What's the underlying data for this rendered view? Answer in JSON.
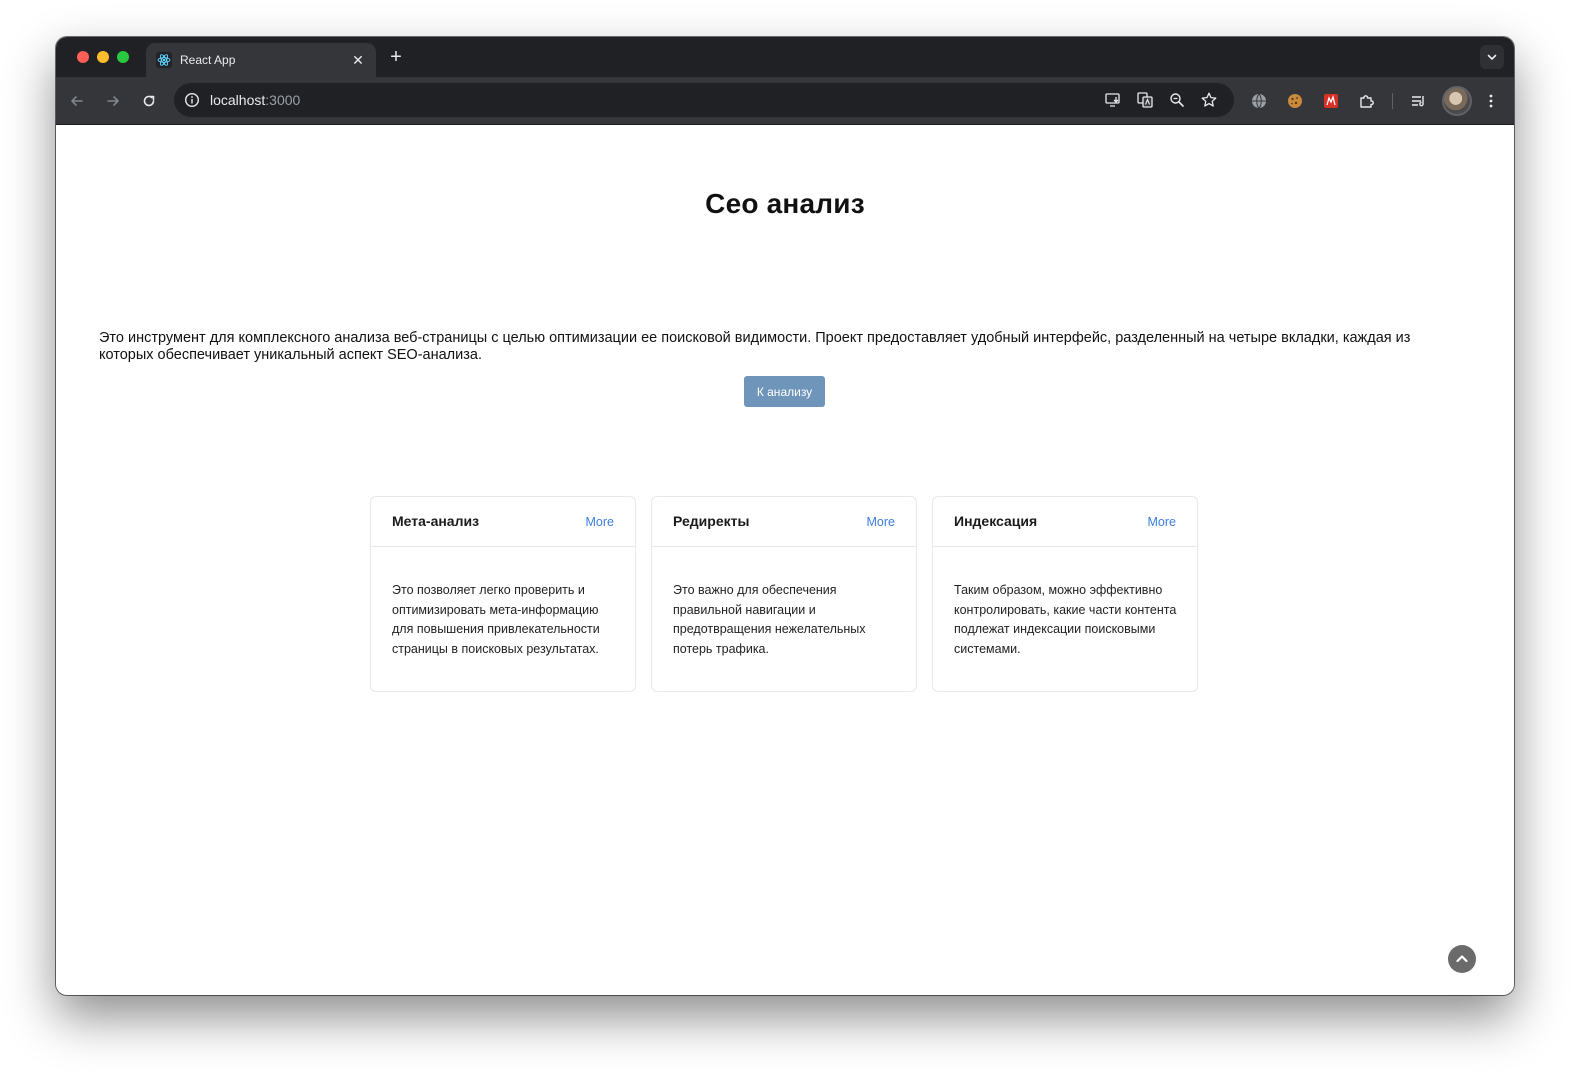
{
  "browser": {
    "tab_title": "React App",
    "tab_close": "✕",
    "new_tab": "+",
    "url_host": "localhost",
    "url_port": ":3000"
  },
  "page": {
    "title": "Сео анализ",
    "intro": "Это инструмент для комплексного анализа веб-страницы с целью оптимизации ее поисковой видимости. Проект предоставляет удобный интерфейс, разделенный на четыре вкладки, каждая из которых обеспечивает уникальный аспект SEO-анализа.",
    "cta_label": "К анализу"
  },
  "cards": [
    {
      "title": "Мета-анализ",
      "more": "More",
      "body": "Это позволяет легко проверить и оптимизировать мета-информацию для повышения привлекательности страницы в поисковых результатах."
    },
    {
      "title": "Редиректы",
      "more": "More",
      "body": "Это важно для обеспечения правильной навигации и предотвращения нежелательных потерь трафика."
    },
    {
      "title": "Индексация",
      "more": "More",
      "body": "Таким образом, можно эффективно контролировать, какие части контента подлежат индексации поисковыми системами."
    }
  ],
  "colors": {
    "cta_bg": "#6f96ba",
    "link": "#3b7ddd",
    "chrome_dark": "#202124",
    "chrome_toolbar": "#35363a"
  }
}
